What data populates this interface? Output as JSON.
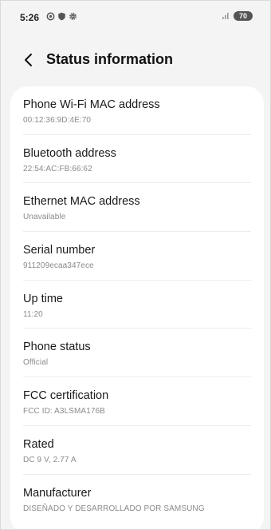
{
  "status_bar": {
    "time": "5:26",
    "battery": "70"
  },
  "header": {
    "title": "Status information"
  },
  "items": [
    {
      "title": "Phone Wi-Fi MAC address",
      "value": "00:12:36:9D:4E:70"
    },
    {
      "title": "Bluetooth address",
      "value": "22:54:AC:FB:66:62"
    },
    {
      "title": "Ethernet MAC address",
      "value": "Unavailable"
    },
    {
      "title": "Serial number",
      "value": "911209ecaa347ece"
    },
    {
      "title": "Up time",
      "value": "11:20"
    },
    {
      "title": "Phone status",
      "value": "Official"
    },
    {
      "title": "FCC certification",
      "value": "FCC ID: A3LSMA176B"
    },
    {
      "title": "Rated",
      "value": "DC 9 V, 2.77 A"
    },
    {
      "title": "Manufacturer",
      "value": "DISEÑADO Y DESARROLLADO POR SAMSUNG"
    }
  ]
}
